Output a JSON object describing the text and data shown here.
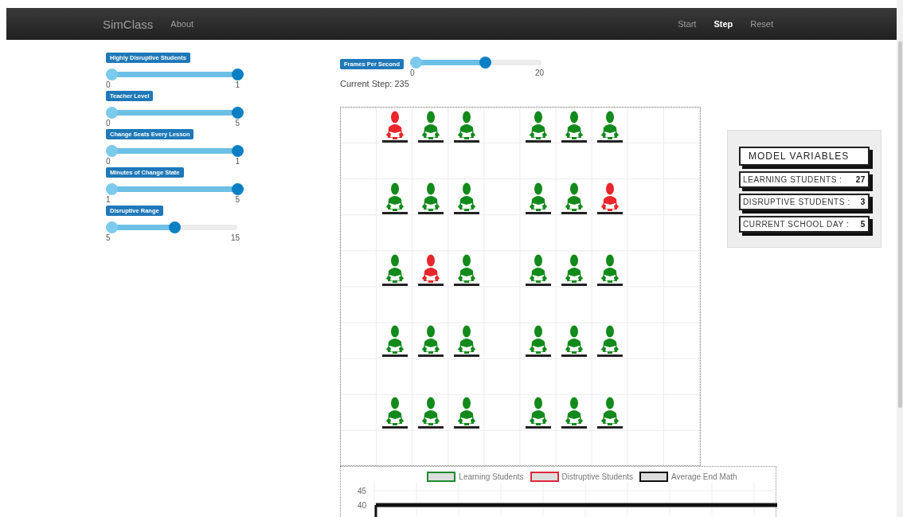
{
  "navbar": {
    "brand": "SimClass",
    "left_links": [
      {
        "label": "About",
        "selected": false
      }
    ],
    "right_links": [
      {
        "label": "Start",
        "selected": false
      },
      {
        "label": "Step",
        "selected": true
      },
      {
        "label": "Reset",
        "selected": false
      }
    ]
  },
  "parameters": [
    {
      "label": "Highly Disruptive Students",
      "min": "0",
      "max": "1",
      "level": 1
    },
    {
      "label": "Teacher Level",
      "min": "0",
      "max": "5",
      "level": 1
    },
    {
      "label": "Change Seats Every Lesson",
      "min": "0",
      "max": "1",
      "level": 1
    },
    {
      "label": "Minutes of Change State",
      "min": "1",
      "max": "5",
      "level": 1
    },
    {
      "label": "Disruptive Range",
      "min": "5",
      "max": "15",
      "level": 0.5
    }
  ],
  "frames_per_second": {
    "label": "Frames Per Second",
    "min": "0",
    "max": "20",
    "level": 0.55
  },
  "current_step": "Current Step: 235",
  "classroom": {
    "rows": [
      {
        "seats": [
          {
            "disruptive": true
          },
          {
            "disruptive": false
          },
          {
            "disruptive": false
          },
          {
            "disruptive": false
          },
          {
            "disruptive": false
          },
          {
            "disruptive": false
          }
        ]
      },
      {
        "seats": [
          {
            "disruptive": false
          },
          {
            "disruptive": false
          },
          {
            "disruptive": false
          },
          {
            "disruptive": false
          },
          {
            "disruptive": false
          },
          {
            "disruptive": true
          }
        ]
      },
      {
        "seats": [
          {
            "disruptive": false
          },
          {
            "disruptive": true
          },
          {
            "disruptive": false
          },
          {
            "disruptive": false
          },
          {
            "disruptive": false
          },
          {
            "disruptive": false
          }
        ]
      },
      {
        "seats": [
          {
            "disruptive": false
          },
          {
            "disruptive": false
          },
          {
            "disruptive": false
          },
          {
            "disruptive": false
          },
          {
            "disruptive": false
          },
          {
            "disruptive": false
          }
        ]
      },
      {
        "seats": [
          {
            "disruptive": false
          },
          {
            "disruptive": false
          },
          {
            "disruptive": false
          },
          {
            "disruptive": false
          },
          {
            "disruptive": false
          },
          {
            "disruptive": false
          }
        ]
      }
    ]
  },
  "model_variables": {
    "title": "MODEL VARIABLES",
    "items": [
      {
        "label": "LEARNING STUDENTS :",
        "value": "27"
      },
      {
        "label": "DISRUPTIVE STUDENTS :",
        "value": "3"
      },
      {
        "label": "CURRENT SCHOOL DAY :",
        "value": "5"
      }
    ]
  },
  "chart": {
    "chart_data": {
      "type": "line",
      "ylim": [
        35,
        45
      ],
      "yticks": [
        45,
        40
      ],
      "series": [
        {
          "name": "Learning Students",
          "color": "#1e8a2e",
          "values": [
            null,
            null,
            null,
            null,
            null,
            null,
            null,
            null,
            null,
            null,
            null
          ]
        },
        {
          "name": "Distruptive Students",
          "color": "#e0263a",
          "values": [
            null,
            null,
            null,
            null,
            null,
            null,
            null,
            null,
            null,
            null,
            null
          ]
        },
        {
          "name": "Average End Math",
          "color": "#111111",
          "values": [
            40,
            40,
            40,
            40,
            40,
            40,
            40,
            40,
            40,
            40,
            40
          ]
        }
      ]
    }
  }
}
